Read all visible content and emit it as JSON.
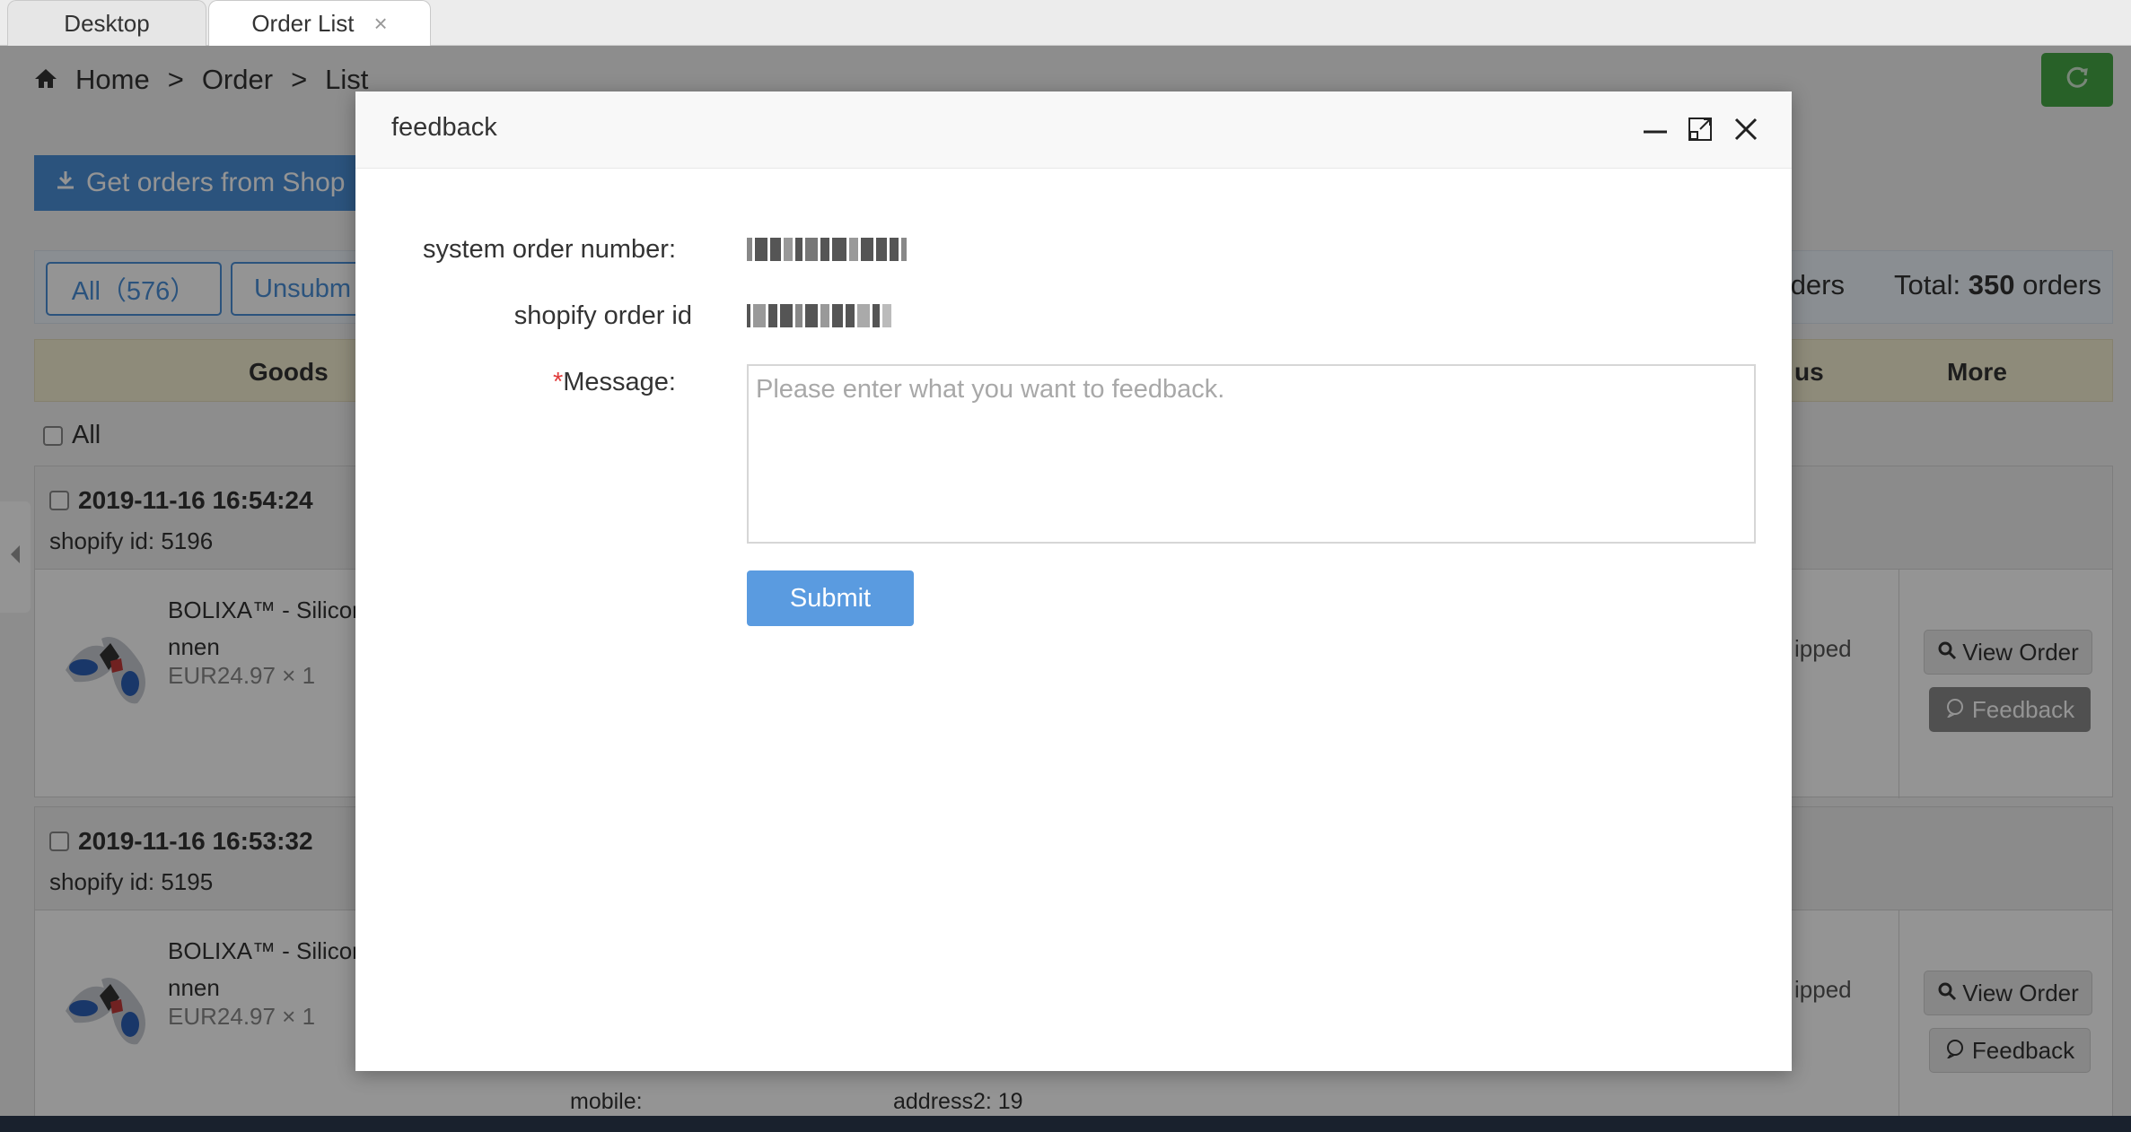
{
  "tabs": [
    {
      "label": "Desktop"
    },
    {
      "label": "Order List",
      "close": "×"
    }
  ],
  "breadcrumb": [
    "Home",
    "Order",
    "List"
  ],
  "breadcrumb_sep": ">",
  "get_orders_label": "Get orders from Shop",
  "filters": {
    "all_label": "All（576）",
    "unsub_label": "Unsubm",
    "orders_partial": "ders",
    "total_label": "Total:",
    "total_count": "350",
    "total_unit": "orders"
  },
  "table_head": {
    "goods": "Goods",
    "status_partial": "us",
    "more": "More"
  },
  "select_all": "All",
  "orders": [
    {
      "date": "2019-11-16 16:54:24",
      "shopify_id_label": "shopify id:",
      "shopify_id": "5196",
      "product_line1": "BOLIXA™ - Silicor",
      "product_line2": "nnen",
      "price": "EUR24.97 × 1",
      "status": "ipped",
      "view_label": "View Order",
      "feedback_label": "Feedback"
    },
    {
      "date": "2019-11-16 16:53:32",
      "shopify_id_label": "shopify id:",
      "shopify_id": "5195",
      "product_line1": "BOLIXA™ - Silicor",
      "product_line2": "nnen",
      "price": "EUR24.97 × 1",
      "status": "ipped",
      "view_label": "View Order",
      "feedback_label": "Feedback",
      "mobile_label": "mobile:",
      "address2_label": "address2:",
      "address2": "19"
    }
  ],
  "modal": {
    "title": "feedback",
    "sys_order_label": "system order number:",
    "shopify_order_label": "shopify order id",
    "message_required": "*",
    "message_label": "Message:",
    "message_placeholder": "Please enter what you want to feedback.",
    "message_value": "",
    "submit_label": "Submit"
  },
  "colors": {
    "accent": "#4a8fd8",
    "submit": "#5a9be0",
    "refresh": "#45a845",
    "required": "#e03c3c"
  }
}
